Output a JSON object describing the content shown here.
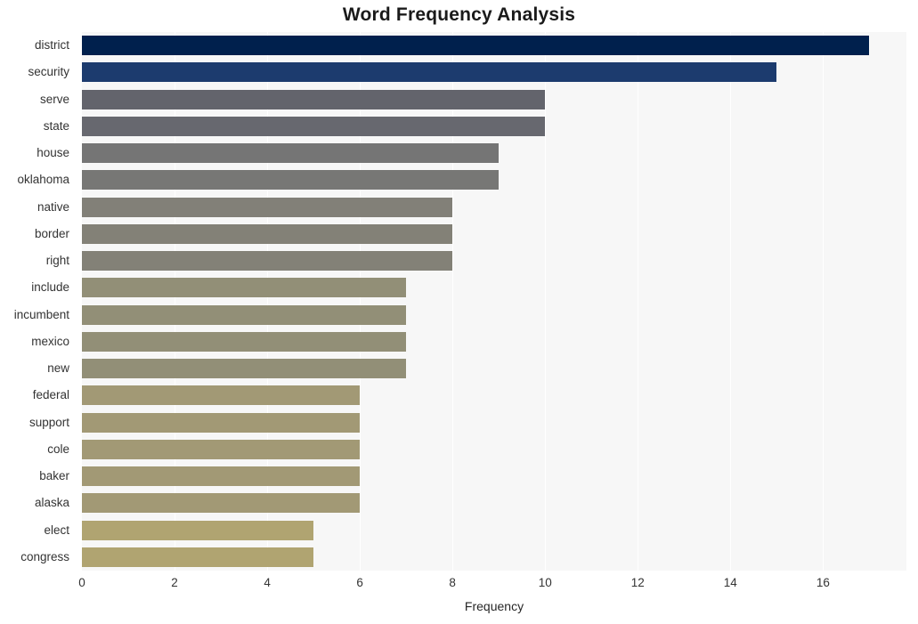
{
  "chart_data": {
    "type": "bar",
    "orientation": "horizontal",
    "title": "Word Frequency Analysis",
    "xlabel": "Frequency",
    "ylabel": "",
    "categories": [
      "district",
      "security",
      "serve",
      "state",
      "house",
      "oklahoma",
      "native",
      "border",
      "right",
      "include",
      "incumbent",
      "mexico",
      "new",
      "federal",
      "support",
      "cole",
      "baker",
      "alaska",
      "elect",
      "congress"
    ],
    "values": [
      17,
      15,
      10,
      10,
      9,
      9,
      8,
      8,
      8,
      7,
      7,
      7,
      7,
      6,
      6,
      6,
      6,
      6,
      5,
      5
    ],
    "bar_colors": [
      "#00204d",
      "#1c3b6e",
      "#63646c",
      "#67686f",
      "#757575",
      "#777775",
      "#828078",
      "#838177",
      "#838177",
      "#928f77",
      "#928f77",
      "#928f77",
      "#928f77",
      "#a29975",
      "#a29975",
      "#a29975",
      "#a29975",
      "#a29975",
      "#b0a471",
      "#b0a471"
    ],
    "xlim": [
      0,
      17.8
    ],
    "xticks": [
      0,
      2,
      4,
      6,
      8,
      10,
      12,
      14,
      16
    ],
    "xtick_labels": [
      "0",
      "2",
      "4",
      "6",
      "8",
      "10",
      "12",
      "14",
      "16"
    ],
    "grid": true,
    "grid_color": "#ffffff",
    "plot_background": "#f7f7f7",
    "figure_background": "#ffffff",
    "title_color": "#1a1a1a",
    "legend": null
  }
}
